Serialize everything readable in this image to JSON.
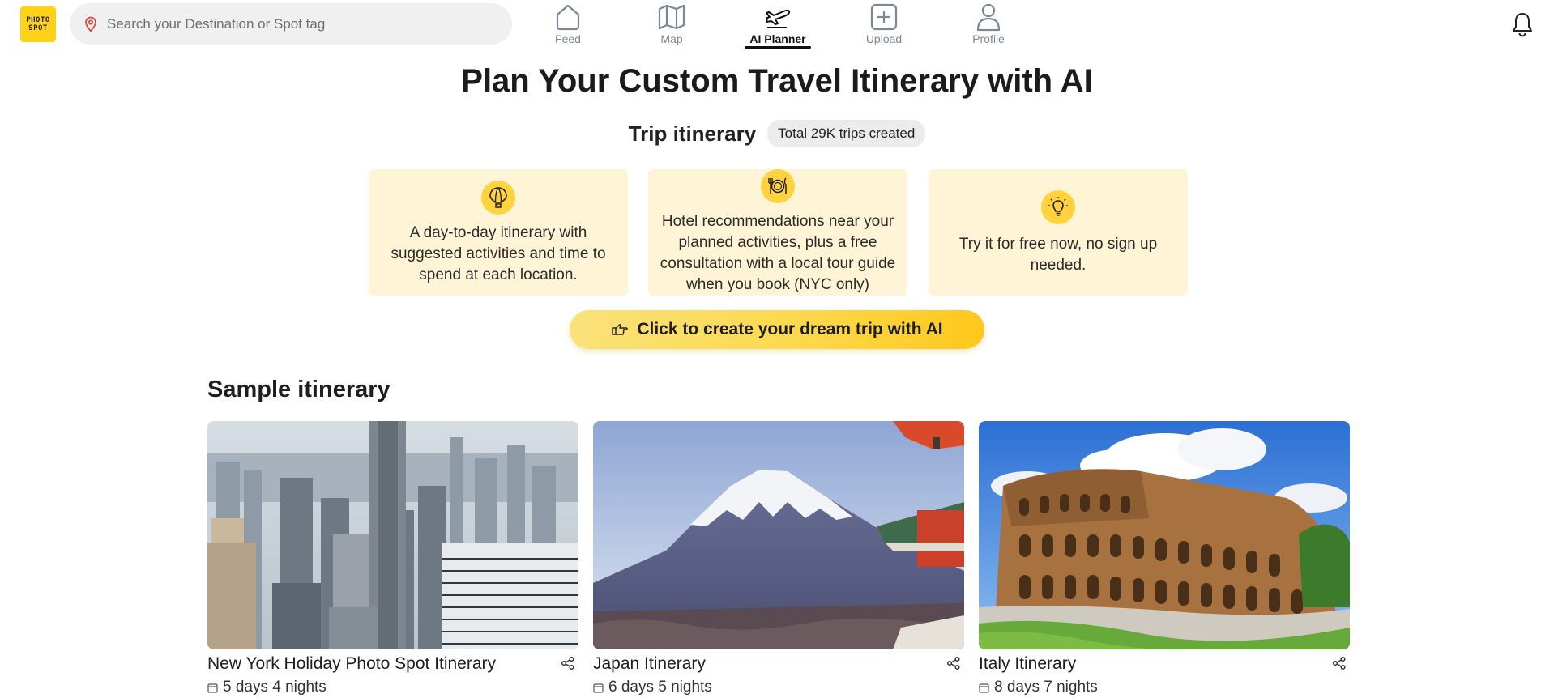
{
  "header": {
    "logo": {
      "line1": "PHOTO",
      "line2": "SPOT"
    },
    "search": {
      "placeholder": "Search your Destination or Spot tag",
      "icon": "location-pin-icon"
    },
    "nav": [
      {
        "label": "Feed",
        "icon": "home-icon",
        "active": false
      },
      {
        "label": "Map",
        "icon": "map-icon",
        "active": false
      },
      {
        "label": "AI Planner",
        "icon": "airplane-icon",
        "active": true
      },
      {
        "label": "Upload",
        "icon": "plus-square-icon",
        "active": false
      },
      {
        "label": "Profile",
        "icon": "user-icon",
        "active": false
      }
    ],
    "notification_icon": "bell-icon"
  },
  "hero": {
    "title": "Plan Your Custom Travel Itinerary with AI",
    "trip_heading": "Trip itinerary",
    "trip_badge": "Total 29K trips created",
    "features": [
      {
        "icon": "hot-air-balloon-icon",
        "text": "A day-to-day itinerary with suggested activities and time to spend at each location."
      },
      {
        "icon": "plate-fork-knife-icon",
        "text": "Hotel recommendations near your planned activities, plus a free consultation with a local tour guide when you book (NYC only)"
      },
      {
        "icon": "lightbulb-icon",
        "text": "Try it for free now, no sign up needed."
      }
    ],
    "cta_label": "Click to create your dream trip with AI",
    "cta_icon": "pointing-hand-icon"
  },
  "samples": {
    "title": "Sample itinerary",
    "cards": [
      {
        "title": "New York Holiday Photo Spot Itinerary",
        "duration": "5 days 4 nights",
        "image": "new-york-skyline-photo"
      },
      {
        "title": "Japan Itinerary",
        "duration": "6 days 5 nights",
        "image": "mount-fuji-photo"
      },
      {
        "title": "Italy Itinerary",
        "duration": "8 days 7 nights",
        "image": "colosseum-photo"
      }
    ]
  },
  "colors": {
    "accent_yellow": "#ffd21a",
    "feature_bg": "#fff5d6",
    "search_bg": "#f0f0f0",
    "nav_inactive": "#7b8794"
  }
}
